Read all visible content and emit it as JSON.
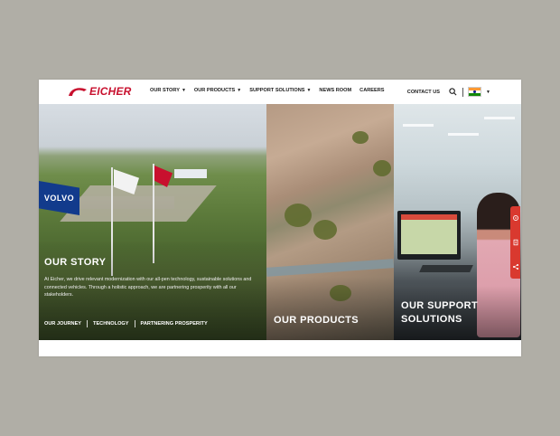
{
  "brand": {
    "name": "EICHER",
    "color": "#c8102e"
  },
  "nav": {
    "items": [
      {
        "label": "OUR STORY",
        "has_dropdown": true
      },
      {
        "label": "OUR PRODUCTS",
        "has_dropdown": true
      },
      {
        "label": "SUPPORT SOLUTIONS",
        "has_dropdown": true
      },
      {
        "label": "NEWS ROOM",
        "has_dropdown": false
      },
      {
        "label": "CAREERS",
        "has_dropdown": false
      }
    ],
    "contact_label": "CONTACT US",
    "search_icon": "search-icon",
    "country_icon": "india-flag-icon"
  },
  "panels": {
    "story": {
      "title": "OUR STORY",
      "description": "At Eicher, we drive relevant modernization with our all-pen technology, sustainable solutions and connected vehicles. Through a holistic approach, we are partnering prosperity with all our stakeholders.",
      "links": [
        "OUR JOURNEY",
        "TECHNOLOGY",
        "PARTNERING PROSPERITY"
      ],
      "flag_text": "VOLVO"
    },
    "products": {
      "title": "OUR PRODUCTS"
    },
    "support": {
      "title_line1": "OUR SUPPORT",
      "title_line2": "SOLUTIONS"
    }
  },
  "side_actions": [
    "locate-icon",
    "brochure-icon",
    "share-icon"
  ],
  "colors": {
    "accent": "#d9392f",
    "text_dark": "#1a1a1a"
  }
}
